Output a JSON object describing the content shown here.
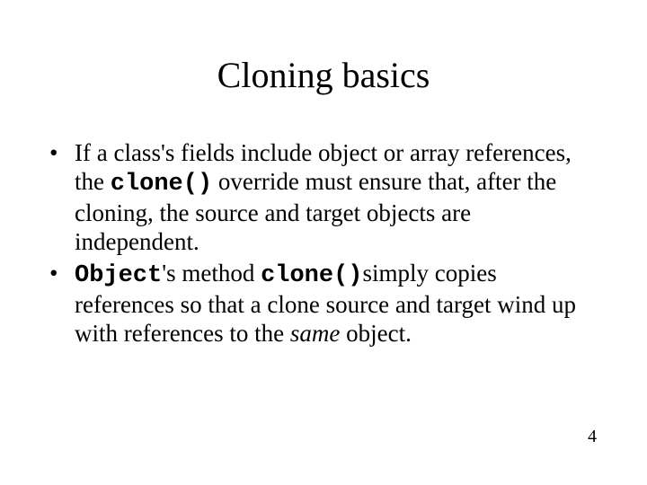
{
  "title": "Cloning basics",
  "bullets": [
    {
      "pre": "If a class's fields include object or array references, the ",
      "code1": "clone()",
      "post": " override must ensure that, after the cloning, the source and target objects are independent."
    },
    {
      "code0": "Object",
      "mid1": "'s method ",
      "code1": "clone()",
      "mid2": "simply copies references so that a clone source and target wind up with references to the ",
      "ital": "same",
      "post": " object."
    }
  ],
  "page_number": "4",
  "bullet_char": "•"
}
